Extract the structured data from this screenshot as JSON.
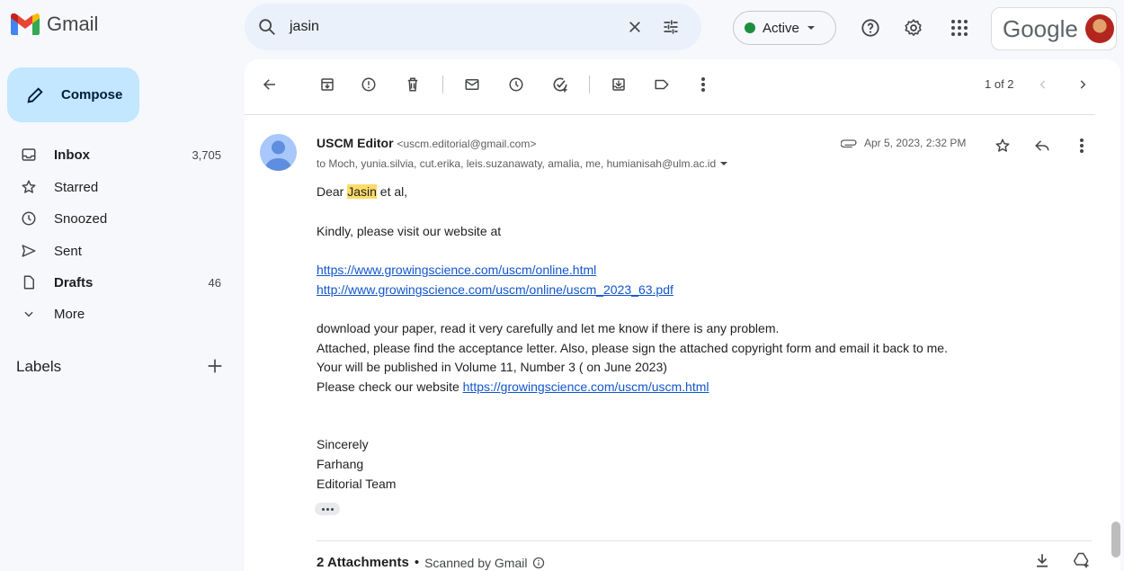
{
  "app": {
    "name": "Gmail"
  },
  "search": {
    "query": "jasin"
  },
  "status": {
    "label": "Active",
    "color": "#1e8e3e"
  },
  "account": {
    "brand": "Google"
  },
  "sidebar": {
    "compose_label": "Compose",
    "items": [
      {
        "label": "Inbox",
        "count": "3,705",
        "icon": "inbox-icon",
        "bold": true
      },
      {
        "label": "Starred",
        "count": "",
        "icon": "star-icon",
        "bold": false
      },
      {
        "label": "Snoozed",
        "count": "",
        "icon": "clock-icon",
        "bold": false
      },
      {
        "label": "Sent",
        "count": "",
        "icon": "send-icon",
        "bold": false
      },
      {
        "label": "Drafts",
        "count": "46",
        "icon": "draft-icon",
        "bold": true
      },
      {
        "label": "More",
        "count": "",
        "icon": "chevron-down-icon",
        "bold": false
      }
    ],
    "labels_heading": "Labels"
  },
  "toolbar": {
    "pager": "1 of 2"
  },
  "email": {
    "sender_name": "USCM Editor",
    "sender_email": "<uscm.editorial@gmail.com>",
    "recipients": "to Moch, yunia.silvia, cut.erika, leis.suzanawaty, amalia, me, humianisah@ulm.ac.id",
    "date": "Apr 5, 2023, 2:32 PM",
    "greeting_pre": "Dear ",
    "greeting_highlight": "Jasin",
    "greeting_post": " et al,",
    "line_visit": "Kindly, please visit our website at",
    "link1": "https://www.growingscience.com/uscm/online.html",
    "link2": "http://www.growingscience.com/uscm/online/uscm_2023_63.pdf",
    "line_download": "download your paper, read it very carefully and let me know if there is any problem.",
    "line_attached": "Attached, please find the acceptance letter. Also, please sign the attached copyright form and email it back to me.",
    "line_volume": "Your will be published in Volume 11, Number 3 ( on June 2023)",
    "line_check": "Please check our website ",
    "link3": "https://growingscience.com/uscm/uscm.html",
    "closing": "Sincerely",
    "sig_name": "Farhang",
    "sig_team": "Editorial Team"
  },
  "attachments": {
    "label": "2 Attachments",
    "separator": "•",
    "scan_text": "Scanned by Gmail"
  }
}
